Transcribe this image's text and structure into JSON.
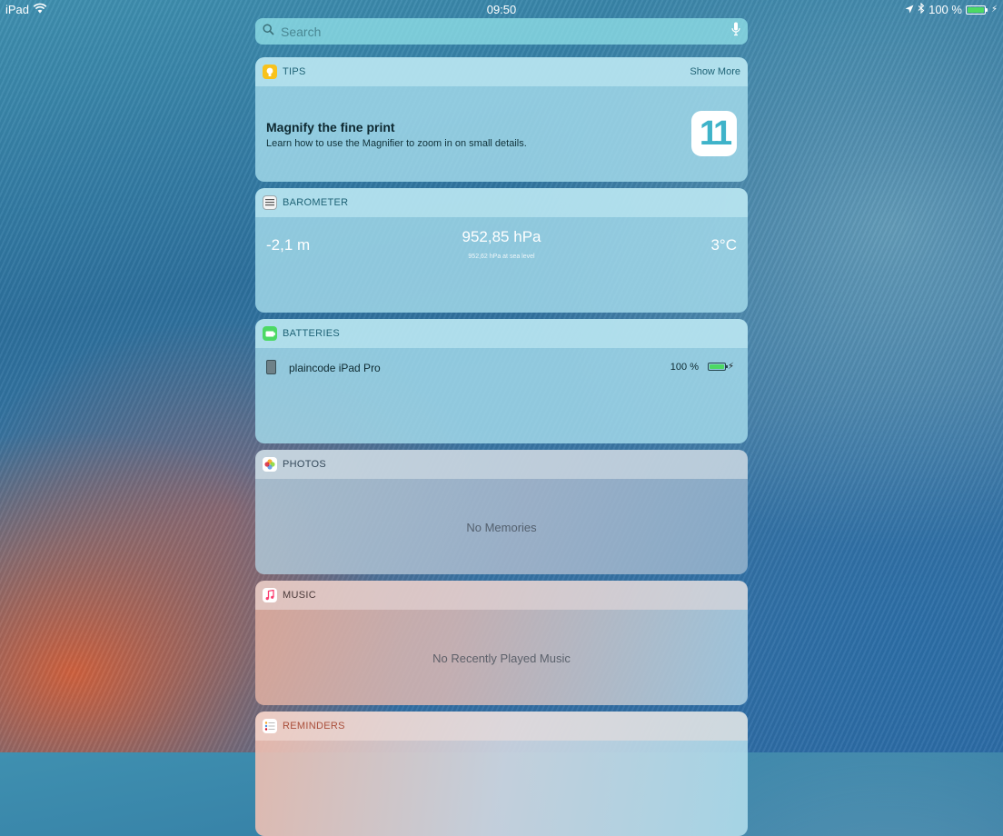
{
  "status_bar": {
    "device": "iPad",
    "time": "09:50",
    "battery_text": "100 %",
    "battery_level": 1.0
  },
  "search": {
    "placeholder": "Search"
  },
  "widgets": {
    "tips": {
      "title": "TIPS",
      "show_more": "Show More",
      "headline": "Magnify the fine print",
      "description": "Learn how to use the Magnifier to zoom in on small details.",
      "badge": "11"
    },
    "barometer": {
      "title": "BAROMETER",
      "altitude": "-2,1 m",
      "pressure": "952,85 hPa",
      "sea_level": "952,62 hPa at sea level",
      "temperature": "3°C"
    },
    "batteries": {
      "title": "BATTERIES",
      "device_name": "plaincode iPad Pro",
      "percent": "100 %",
      "level": 1.0
    },
    "photos": {
      "title": "PHOTOS",
      "empty": "No Memories"
    },
    "music": {
      "title": "MUSIC",
      "empty": "No Recently Played Music"
    },
    "reminders": {
      "title": "REMINDERS"
    }
  },
  "colors": {
    "tips_icon": "#f8c21c",
    "batteries_icon": "#4cd964",
    "reminders_text": "#a94e3a",
    "header_text": "#1f6376"
  }
}
